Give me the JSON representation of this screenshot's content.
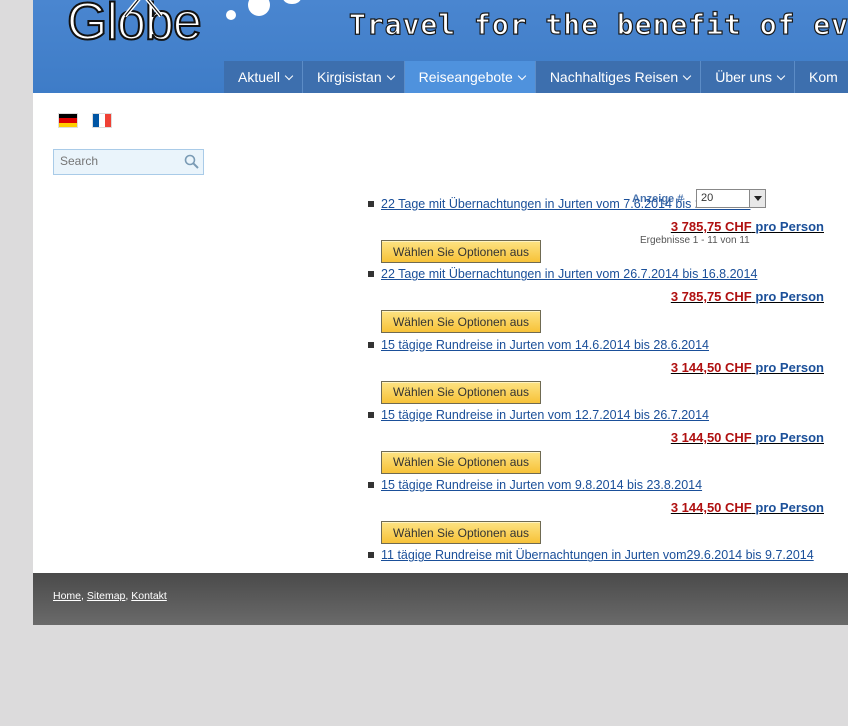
{
  "logo": {
    "text": "Globe"
  },
  "header": {
    "tagline": "Travel for the benefit of everyb"
  },
  "nav": {
    "items": [
      {
        "label": "Aktuell"
      },
      {
        "label": "Kirgisistan"
      },
      {
        "label": "Reiseangebote"
      },
      {
        "label": "Nachhaltiges Reisen"
      },
      {
        "label": "Über uns"
      },
      {
        "label": "Kom"
      }
    ],
    "active": "Reiseangebote"
  },
  "languages": [
    {
      "code": "de",
      "icon": "german-flag-icon",
      "colors": [
        "#000000",
        "#dd0000",
        "#ffce00"
      ]
    },
    {
      "code": "fr",
      "icon": "french-flag-icon",
      "colors": [
        "#0055a4",
        "#ffffff",
        "#ef4135"
      ]
    }
  ],
  "search": {
    "placeholder": "Search"
  },
  "display": {
    "label": "Anzeige #",
    "value": "20"
  },
  "results": {
    "count_text": "Ergebnisse 1 - 11 von 11"
  },
  "products": [
    {
      "title": "22 Tage mit Übernachtungen in Jurten vom 7.6.2014 bis 28.6.2014 ",
      "price": "3 785,75 CHF",
      "per": "pro Person",
      "button": "Wählen Sie Optionen aus"
    },
    {
      "title": "22 Tage mit Übernachtungen in Jurten vom 26.7.2014 bis 16.8.2014 ",
      "price": "3 785,75 CHF",
      "per": "pro Person",
      "button": "Wählen Sie Optionen aus"
    },
    {
      "title": "15 tägige Rundreise in Jurten vom 14.6.2014 bis 28.6.2014 ",
      "price": "3 144,50 CHF",
      "per": "pro Person",
      "button": "Wählen Sie Optionen aus"
    },
    {
      "title": "15 tägige Rundreise in Jurten vom 12.7.2014 bis 26.7.2014 ",
      "price": "3 144,50 CHF",
      "per": "pro Person",
      "button": "Wählen Sie Optionen aus"
    },
    {
      "title": "15 tägige Rundreise in Jurten vom 9.8.2014 bis 23.8.2014 ",
      "price": "3 144,50 CHF",
      "per": "pro Person",
      "button": "Wählen Sie Optionen aus"
    },
    {
      "title": "11 tägige Rundreise mit Übernachtungen in Jurten vom29.6.2014 bis 9.7.2014 ",
      "price": "",
      "per": "",
      "button": ""
    }
  ],
  "footer": {
    "links": [
      "Home",
      "Sitemap",
      "Kontakt"
    ]
  },
  "colors": {
    "header_blue": "#4a86d0",
    "nav_active": "#4f92dd",
    "price_red": "#b01010",
    "link_blue": "#1a4f99",
    "button_yellow": "#f7c238"
  }
}
